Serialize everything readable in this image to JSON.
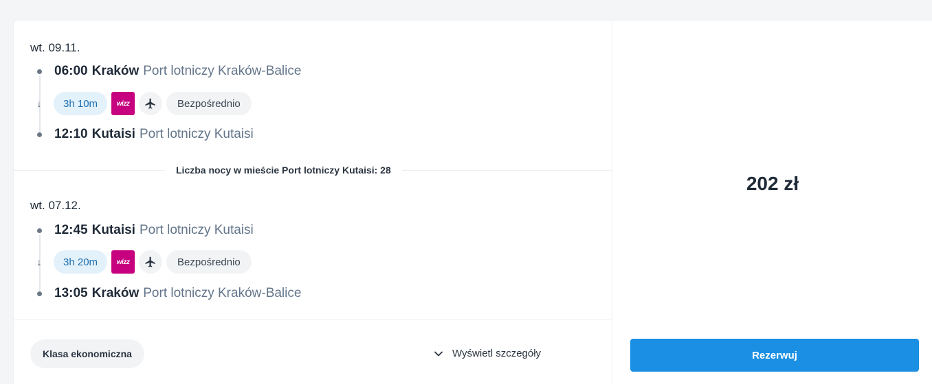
{
  "outbound": {
    "date": "wt. 09.11.",
    "departure": {
      "time": "06:00",
      "city": "Kraków",
      "airport": "Port lotniczy Kraków-Balice"
    },
    "duration": "3h 10m",
    "airline_logo": "wizz",
    "stops": "Bezpośrednio",
    "arrival": {
      "time": "12:10",
      "city": "Kutaisi",
      "airport": "Port lotniczy Kutaisi"
    }
  },
  "nights_text": "Liczba nocy w mieście Port lotniczy Kutaisi: 28",
  "return": {
    "date": "wt. 07.12.",
    "departure": {
      "time": "12:45",
      "city": "Kutaisi",
      "airport": "Port lotniczy Kutaisi"
    },
    "duration": "3h 20m",
    "airline_logo": "wizz",
    "stops": "Bezpośrednio",
    "arrival": {
      "time": "13:05",
      "city": "Kraków",
      "airport": "Port lotniczy Kraków-Balice"
    }
  },
  "fare_class": "Klasa ekonomiczna",
  "details_label": "Wyświetl szczegóły",
  "price": "202 zł",
  "book_label": "Rezerwuj",
  "icons": {
    "plane": "plane-icon",
    "arrow": "arrow-down-icon",
    "chevron": "chevron-down-icon"
  },
  "colors": {
    "primary": "#1a8fe3",
    "wizz": "#c6007e",
    "duration_bg": "#e3f1fb"
  }
}
